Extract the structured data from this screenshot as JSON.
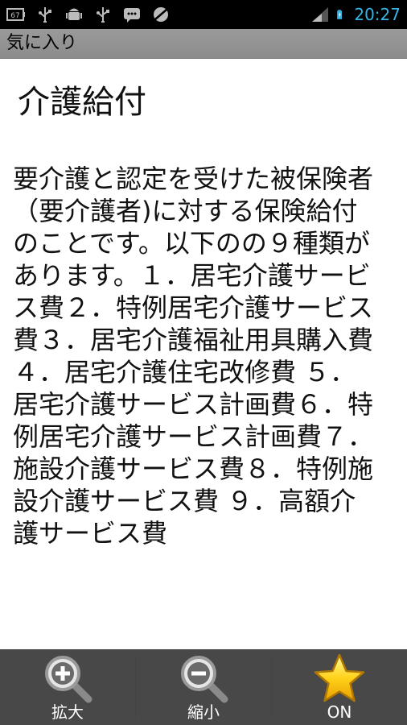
{
  "status_bar": {
    "time": "20:27",
    "left_icons": [
      "battery-67-icon",
      "usb-icon",
      "android-debug-icon",
      "usb-icon",
      "message-icon",
      "no-signal-icon"
    ],
    "right_icons": [
      "signal-bars-icon",
      "battery-charging-icon"
    ],
    "accent_color": "#33b5e5"
  },
  "title_bar": {
    "title": "気に入り"
  },
  "article": {
    "heading": "介護給付",
    "body": "要介護と認定を受けた被保険者（要介護者)に対する保険給付のことです。以下のの９種類があります。１．居宅介護サービス費２．特例居宅介護サービス費３．居宅介護福祉用具購入費 ４．居宅介護住宅改修費 ５．居宅介護サービス計画費６．特例居宅介護サービス計画費７．施設介護サービス費８．特例施設介護サービス費 ９．高額介護サービス費"
  },
  "toolbar": {
    "zoom_in_label": "拡大",
    "zoom_out_label": "縮小",
    "favorite_label": "ON"
  }
}
